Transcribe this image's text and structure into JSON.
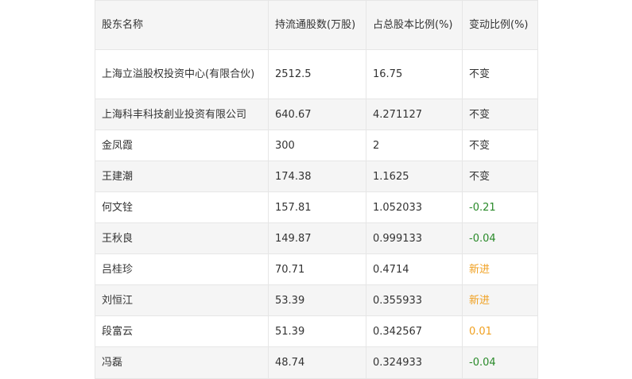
{
  "table": {
    "headers": [
      "股东名称",
      "持流通股数(万股)",
      "占总股本比例(%)",
      "变动比例(%)"
    ],
    "rows": [
      {
        "name": "上海立溢股权投资中心(有限合伙)",
        "shares": "2512.5",
        "ratio": "16.75",
        "change": "不变",
        "change_type": "same"
      },
      {
        "name": "上海科丰科技創业投资有限公司",
        "shares": "640.67",
        "ratio": "4.271127",
        "change": "不变",
        "change_type": "same"
      },
      {
        "name": "金凤霞",
        "shares": "300",
        "ratio": "2",
        "change": "不变",
        "change_type": "same"
      },
      {
        "name": "王建潮",
        "shares": "174.38",
        "ratio": "1.1625",
        "change": "不变",
        "change_type": "same"
      },
      {
        "name": "何文铨",
        "shares": "157.81",
        "ratio": "1.052033",
        "change": "-0.21",
        "change_type": "neg"
      },
      {
        "name": "王秋良",
        "shares": "149.87",
        "ratio": "0.999133",
        "change": "-0.04",
        "change_type": "neg"
      },
      {
        "name": "吕桂珍",
        "shares": "70.71",
        "ratio": "0.4714",
        "change": "新进",
        "change_type": "new"
      },
      {
        "name": "刘恒江",
        "shares": "53.39",
        "ratio": "0.355933",
        "change": "新进",
        "change_type": "new"
      },
      {
        "name": "段富云",
        "shares": "51.39",
        "ratio": "0.342567",
        "change": "0.01",
        "change_type": "pos"
      },
      {
        "name": "冯磊",
        "shares": "48.74",
        "ratio": "0.324933",
        "change": "-0.04",
        "change_type": "neg"
      }
    ]
  },
  "colors": {
    "negative": "#2a8a2a",
    "new": "#f0a020",
    "positive": "#f0a020",
    "header_bg": "#f5f5f5",
    "border": "#e6e6e6"
  }
}
